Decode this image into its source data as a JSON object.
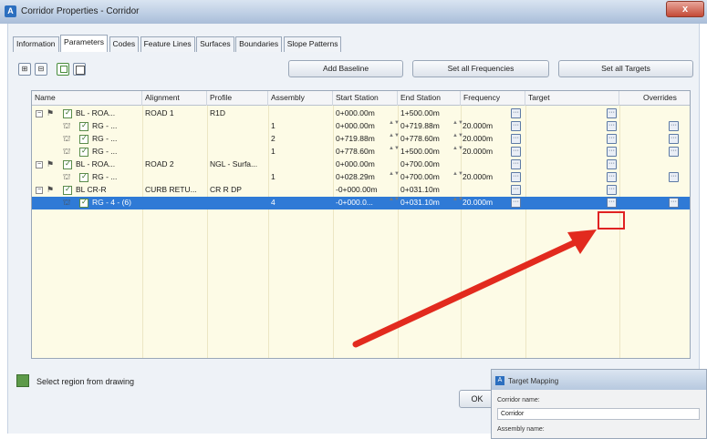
{
  "window": {
    "title": "Corridor Properties - Corridor",
    "close_glyph": "x"
  },
  "tabs": [
    "Information",
    "Parameters",
    "Codes",
    "Feature Lines",
    "Surfaces",
    "Boundaries",
    "Slope Patterns"
  ],
  "active_tab": "Parameters",
  "toolbar": {
    "add_baseline": "Add Baseline",
    "set_all_frequencies": "Set all Frequencies",
    "set_all_targets": "Set all Targets"
  },
  "grid": {
    "columns": [
      "Name",
      "Alignment",
      "Profile",
      "Assembly",
      "Start Station",
      "End Station",
      "Frequency",
      "Target",
      "Overrides"
    ],
    "rows": [
      {
        "level": 0,
        "name": "BL - ROA...",
        "alignment": "ROAD 1",
        "profile": "R1D",
        "assembly": "",
        "start": "0+000.00m",
        "end": "1+500.00m",
        "frequency": "",
        "freq_btn": true,
        "target_btn": true,
        "override_btn": false
      },
      {
        "level": 1,
        "name": "RG - ...",
        "alignment": "",
        "profile": "",
        "assembly": "1",
        "start": "0+000.00m",
        "end": "0+719.88m",
        "frequency": "20.000m",
        "freq_btn": true,
        "target_btn": true,
        "override_btn": true
      },
      {
        "level": 1,
        "name": "RG - ...",
        "alignment": "",
        "profile": "",
        "assembly": "2",
        "start": "0+719.88m",
        "end": "0+778.60m",
        "frequency": "20.000m",
        "freq_btn": true,
        "target_btn": true,
        "override_btn": true
      },
      {
        "level": 1,
        "name": "RG - ...",
        "alignment": "",
        "profile": "",
        "assembly": "1",
        "start": "0+778.60m",
        "end": "1+500.00m",
        "frequency": "20.000m",
        "freq_btn": true,
        "target_btn": true,
        "override_btn": true
      },
      {
        "level": 0,
        "name": "BL - ROA...",
        "alignment": "ROAD 2",
        "profile": "NGL - Surfa...",
        "assembly": "",
        "start": "0+000.00m",
        "end": "0+700.00m",
        "frequency": "",
        "freq_btn": true,
        "target_btn": true,
        "override_btn": false
      },
      {
        "level": 1,
        "name": "RG - ...",
        "alignment": "",
        "profile": "",
        "assembly": "1",
        "start": "0+028.29m",
        "end": "0+700.00m",
        "frequency": "20.000m",
        "freq_btn": true,
        "target_btn": true,
        "override_btn": true
      },
      {
        "level": 0,
        "name": "BL CR-R",
        "alignment": "CURB RETU...",
        "profile": "CR R DP",
        "assembly": "",
        "start": "-0+000.00m",
        "end": "0+031.10m",
        "frequency": "",
        "freq_btn": true,
        "target_btn": true,
        "override_btn": false
      },
      {
        "level": 1,
        "name": "RG - 4 - (6)",
        "alignment": "",
        "profile": "",
        "assembly": "4",
        "start": "-0+000.0...",
        "end": "0+031.10m",
        "frequency": "20.000m",
        "freq_btn": true,
        "target_btn": true,
        "override_btn": true,
        "selected": true
      }
    ]
  },
  "status": {
    "text": "Select region from drawing"
  },
  "ok_button": "OK",
  "target_mapping": {
    "title": "Target Mapping",
    "corridor_label": "Corridor name:",
    "corridor_value": "Corridor",
    "assembly_label": "Assembly name:"
  },
  "colors": {
    "selection": "#2f7ad6",
    "highlight_box": "#e02222",
    "arrow": "#e22a1e",
    "grid_bg": "#fdfbe6"
  }
}
